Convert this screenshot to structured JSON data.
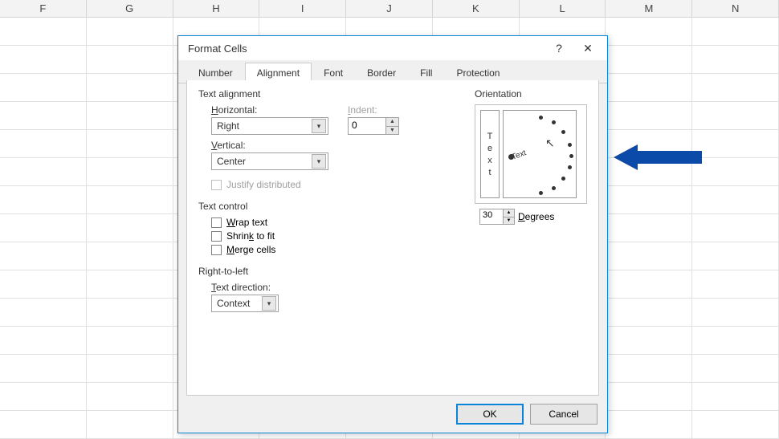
{
  "sheet": {
    "columns": [
      "F",
      "G",
      "H",
      "I",
      "J",
      "K",
      "L",
      "M",
      "N"
    ]
  },
  "dialog": {
    "title": "Format Cells",
    "help": "?",
    "close": "✕",
    "tabs": [
      "Number",
      "Alignment",
      "Font",
      "Border",
      "Fill",
      "Protection"
    ],
    "activeTab": "Alignment",
    "textAlignment": {
      "section": "Text alignment",
      "horizontalLabel": "Horizontal:",
      "horizontalValue": "Right",
      "verticalLabel": "Vertical:",
      "verticalValue": "Center",
      "indentLabel": "Indent:",
      "indentValue": "0",
      "justifyDistributed": "Justify distributed"
    },
    "textControl": {
      "section": "Text control",
      "wrapText": "Wrap text",
      "shrinkToFit": "Shrink to fit",
      "mergeCells": "Merge cells"
    },
    "rightToLeft": {
      "section": "Right-to-left",
      "textDirectionLabel": "Text direction:",
      "textDirectionValue": "Context"
    },
    "orientation": {
      "section": "Orientation",
      "verticalText": [
        "T",
        "e",
        "x",
        "t"
      ],
      "dialText": "Text",
      "degreesLabel": "Degrees",
      "degreesValue": "30"
    },
    "buttons": {
      "ok": "OK",
      "cancel": "Cancel"
    }
  }
}
